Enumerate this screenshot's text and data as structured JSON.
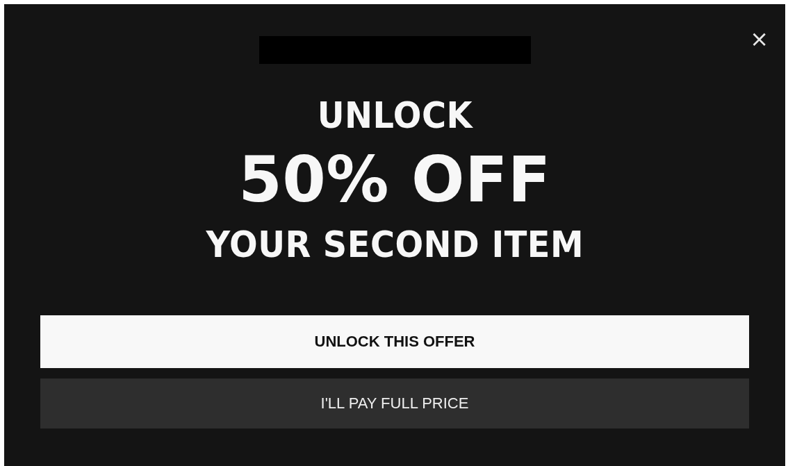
{
  "close_button": "×",
  "headline": [
    {
      "text": "UNLOCK",
      "kind": "small"
    },
    {
      "text": "50% OFF",
      "kind": "large"
    },
    {
      "text": "YOUR SECOND ITEM",
      "kind": "small"
    }
  ],
  "buttons": [
    {
      "label": "UNLOCK THIS OFFER",
      "kind": "primary"
    },
    {
      "label": "I'LL PAY FULL PRICE",
      "kind": "secondary"
    }
  ]
}
